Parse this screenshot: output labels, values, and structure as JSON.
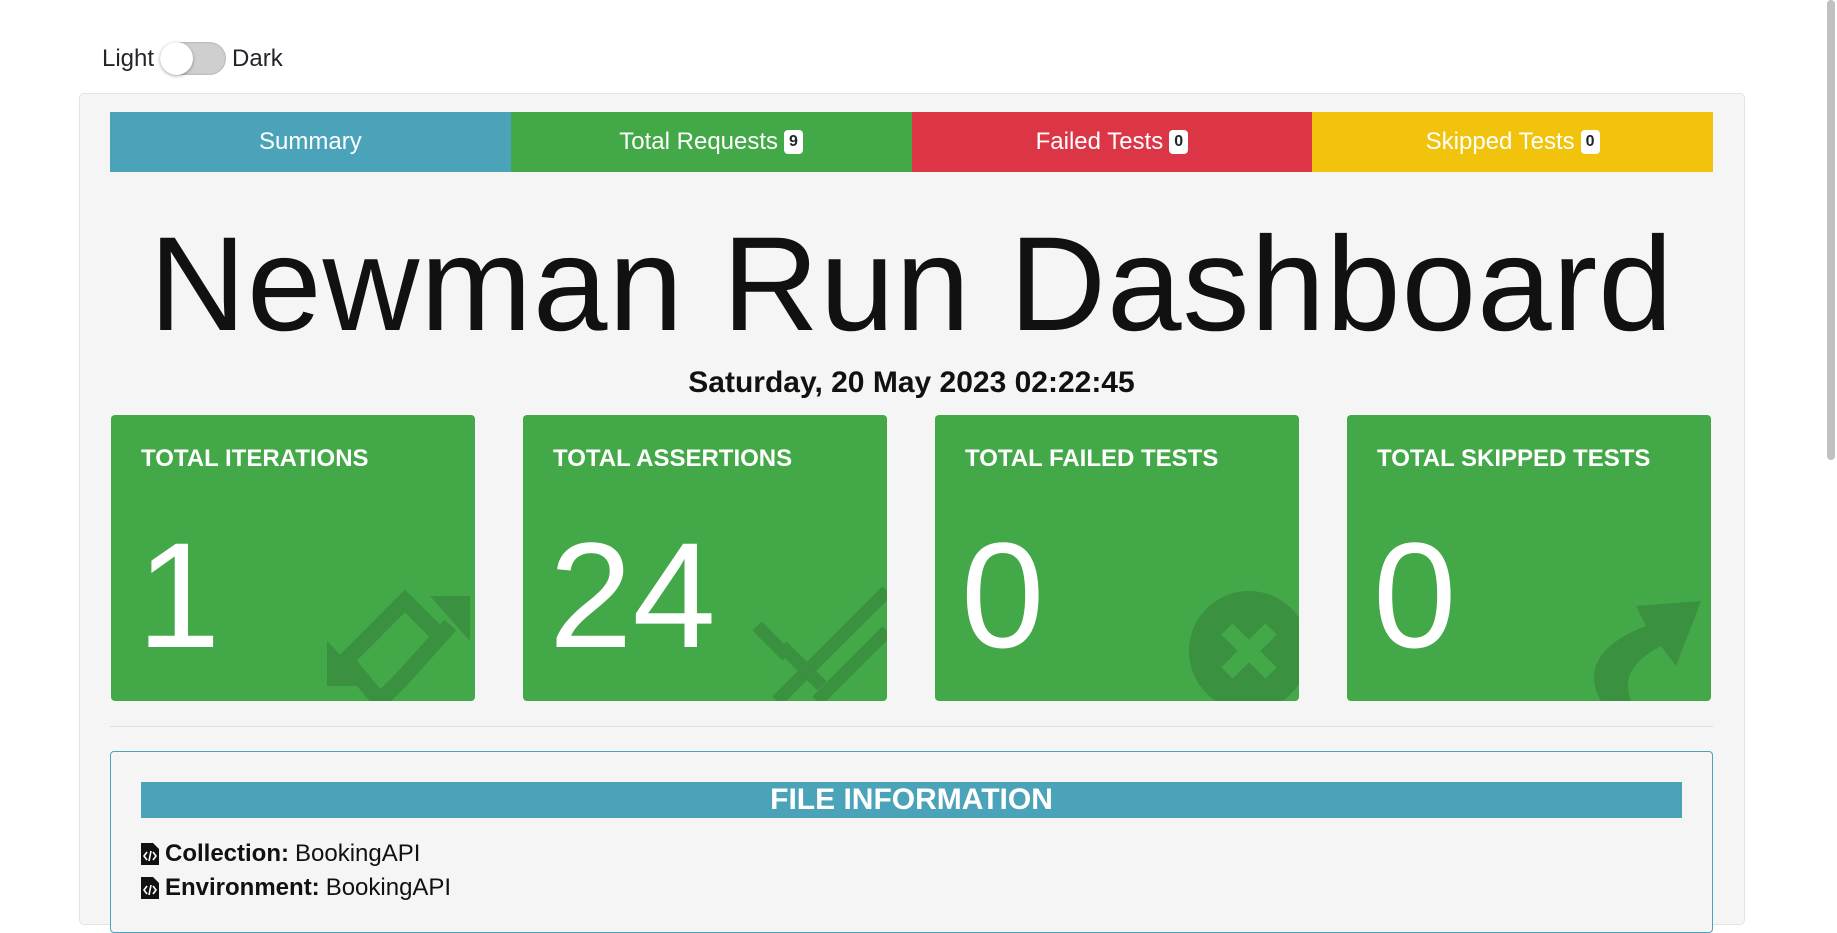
{
  "theme": {
    "light_label": "Light",
    "dark_label": "Dark"
  },
  "tabs": [
    {
      "label": "Summary",
      "badge": null,
      "color": "#4aa3b8"
    },
    {
      "label": "Total Requests",
      "badge": "9",
      "color": "#43a847"
    },
    {
      "label": "Failed Tests",
      "badge": "0",
      "color": "#dc3545"
    },
    {
      "label": "Skipped Tests",
      "badge": "0",
      "color": "#f2c30c"
    }
  ],
  "title": "Newman Run Dashboard",
  "date": "Saturday, 20 May 2023 02:22:45",
  "cards": [
    {
      "label": "TOTAL ITERATIONS",
      "value": "1",
      "icon": "sync-icon"
    },
    {
      "label": "TOTAL ASSERTIONS",
      "value": "24",
      "icon": "asterisk-icon"
    },
    {
      "label": "TOTAL FAILED TESTS",
      "value": "0",
      "icon": "times-circle-icon"
    },
    {
      "label": "TOTAL SKIPPED TESTS",
      "value": "0",
      "icon": "share-icon"
    }
  ],
  "file_info": {
    "header": "FILE INFORMATION",
    "collection_label": "Collection:",
    "collection_value": "BookingAPI",
    "environment_label": "Environment:",
    "environment_value": "BookingAPI"
  },
  "colors": {
    "accent": "#4aa3b8",
    "success": "#43a847",
    "danger": "#dc3545",
    "warning": "#f2c30c"
  }
}
